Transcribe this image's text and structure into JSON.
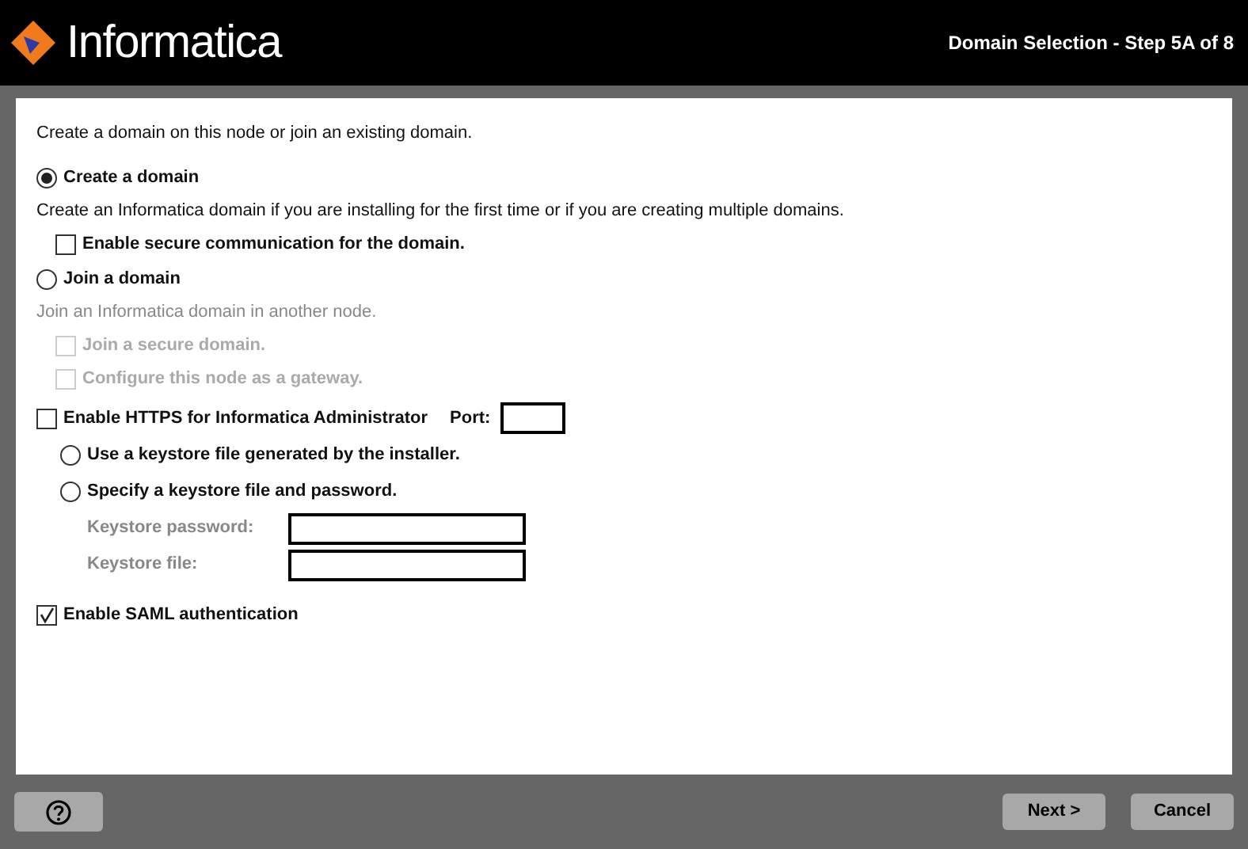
{
  "header": {
    "brand": "Informatica",
    "step": "Domain Selection - Step 5A of 8"
  },
  "intro": "Create a domain on this node or join an existing domain.",
  "domain_options": [
    {
      "label": "Create a domain",
      "selected": true,
      "description": "Create an Informatica domain if you are installing for the first time or if you are creating multiple domains.",
      "children": [
        {
          "label": "Enable secure communication for the domain.",
          "checked": false,
          "disabled": false
        }
      ]
    },
    {
      "label": "Join a domain",
      "selected": false,
      "description": "Join an Informatica domain in another node.",
      "children": [
        {
          "label": "Join a secure domain.",
          "checked": false,
          "disabled": true
        },
        {
          "label": "Configure this node as a gateway.",
          "checked": false,
          "disabled": true
        }
      ]
    }
  ],
  "https": {
    "label": "Enable HTTPS for Informatica Administrator",
    "checked": false,
    "port_label": "Port:",
    "keystore_options": [
      {
        "label": "Use a keystore file generated by the installer.",
        "selected": false
      },
      {
        "label": "Specify a keystore file and password.",
        "selected": false
      }
    ],
    "fields": [
      {
        "label": "Keystore password:",
        "disabled": true
      },
      {
        "label": "Keystore file:",
        "disabled": true
      }
    ]
  },
  "saml": {
    "label": "Enable SAML authentication",
    "checked": true
  },
  "footer": {
    "buttons": [
      {
        "label": "Next >"
      },
      {
        "label": "Cancel"
      }
    ]
  }
}
